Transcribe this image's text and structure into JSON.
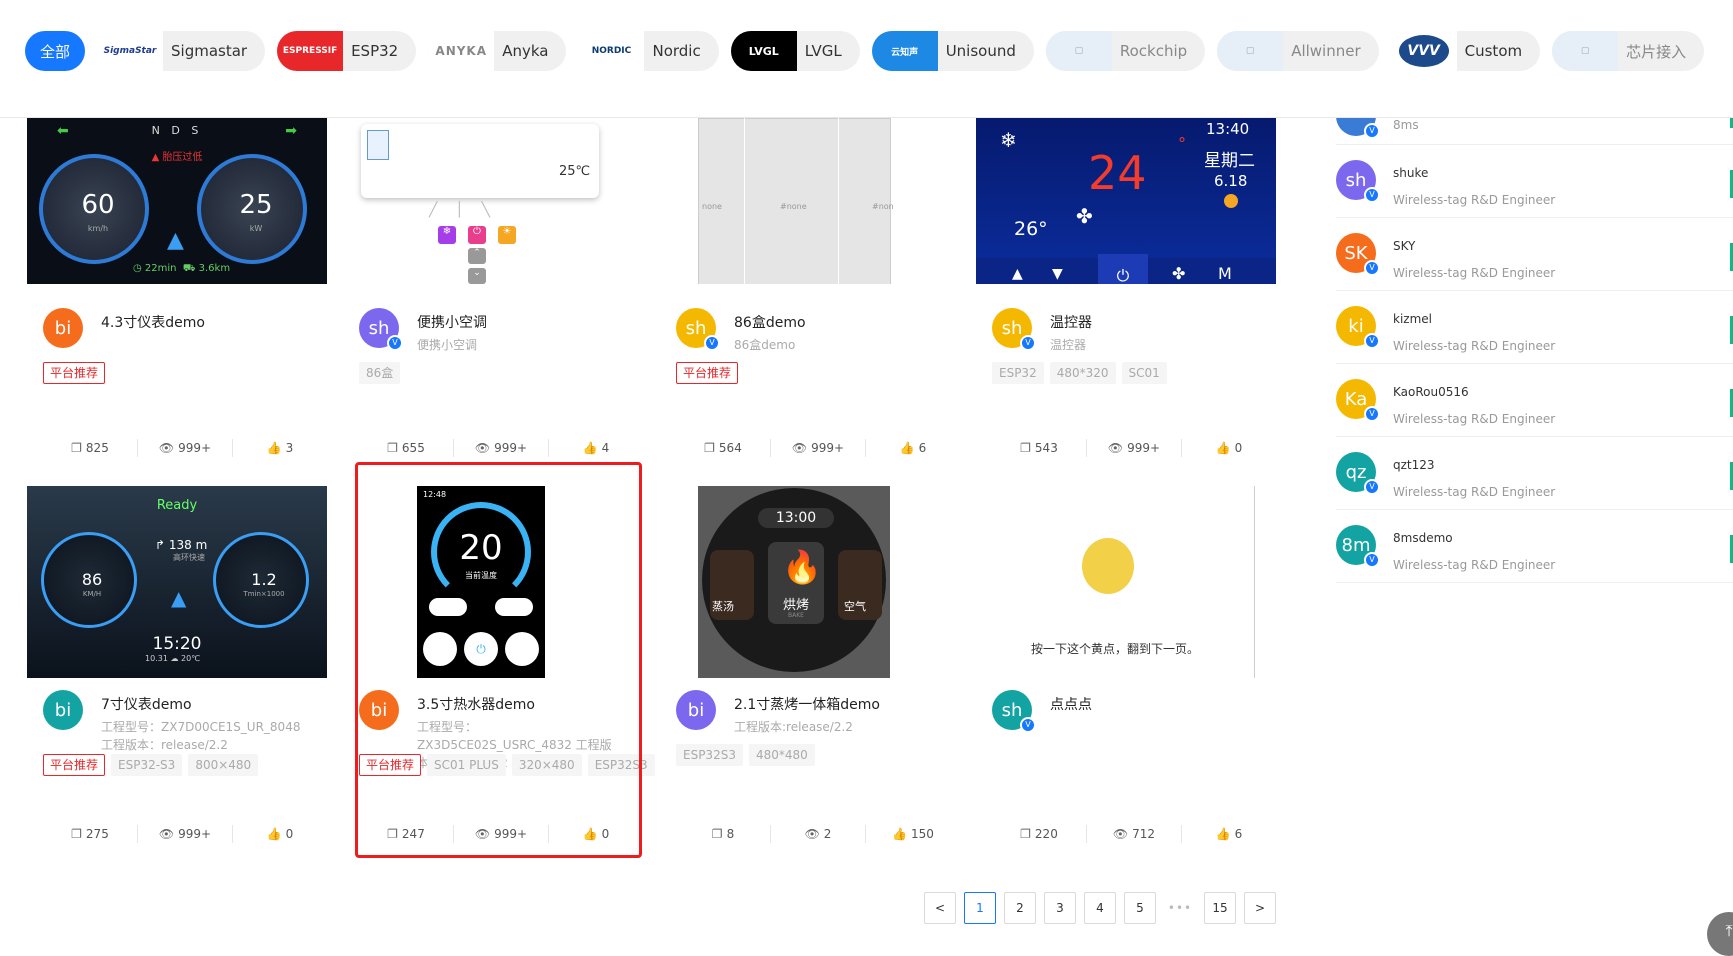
{
  "filters": [
    {
      "label": "全部",
      "active": true
    },
    {
      "label": "Sigmastar",
      "logo": "SigmaStar"
    },
    {
      "label": "ESP32",
      "logo": "ESPRESSIF"
    },
    {
      "label": "Anyka",
      "logo": "ANYKA"
    },
    {
      "label": "Nordic",
      "logo": "NORDIC"
    },
    {
      "label": "LVGL",
      "logo": "LVGL"
    },
    {
      "label": "Unisound",
      "logo": "云知声"
    },
    {
      "label": "Rockchip",
      "dim": true
    },
    {
      "label": "Allwinner",
      "dim": true
    },
    {
      "label": "Custom",
      "logo": "VVV"
    },
    {
      "label": "芯片接入",
      "dim": true
    }
  ],
  "cards": [
    {
      "title": "4.3寸仪表demo",
      "desc": "",
      "avatar": "bi",
      "avatar_color": "#f56c1d",
      "verified": false,
      "tags": [
        "平台推荐"
      ],
      "rec": true,
      "copies": "825",
      "views": "999+",
      "likes": "3",
      "thumb": {
        "type": "dash1",
        "top_text": "N D S",
        "warn": "胎压过低",
        "speed": "60",
        "speed_unit": "km/h",
        "right_val": "25",
        "right_unit": "kW",
        "trip1": "22min",
        "trip2": "3.6km"
      }
    },
    {
      "title": "便携小空调",
      "desc": "便携小空调",
      "avatar": "sh",
      "avatar_color": "#7b68ee",
      "verified": true,
      "tags": [
        "86盒"
      ],
      "rec": false,
      "copies": "655",
      "views": "999+",
      "likes": "4",
      "thumb": {
        "type": "ac",
        "temp": "25℃"
      }
    },
    {
      "title": "86盒demo",
      "desc": "86盒demo",
      "avatar": "sh",
      "avatar_color": "#f5b800",
      "verified": true,
      "tags": [
        "平台推荐"
      ],
      "rec": true,
      "copies": "564",
      "views": "999+",
      "likes": "6",
      "thumb": {
        "type": "none",
        "labels": [
          "none",
          "#none",
          "#non"
        ]
      }
    },
    {
      "title": "温控器",
      "desc": "温控器",
      "avatar": "sh",
      "avatar_color": "#f5b800",
      "verified": true,
      "tags": [
        "ESP32",
        "480*320",
        "SC01"
      ],
      "rec": false,
      "copies": "543",
      "views": "999+",
      "likes": "0",
      "thumb": {
        "type": "thermo",
        "time": "13:40",
        "temp": "24",
        "day": "星期二",
        "date": "6.18",
        "indoor": "26°",
        "mode": "M"
      }
    },
    {
      "title": "7寸仪表demo",
      "desc": "工程型号：ZX7D00CE1S_UR_8048 工程版本：release/2.2",
      "avatar": "bi",
      "avatar_color": "#14a3a3",
      "verified": false,
      "tags": [
        "平台推荐",
        "ESP32-S3",
        "800×480"
      ],
      "rec": true,
      "copies": "275",
      "views": "999+",
      "likes": "0",
      "thumb": {
        "type": "dash2",
        "status": "Ready",
        "dist": "138 m",
        "dist_sub": "高环快速",
        "speed": "86",
        "speed_unit": "KM/H",
        "rpm": "1.2",
        "rpm_unit": "Tmin×1000",
        "clock": "15:20",
        "date": "10.31",
        "weather": "20℃"
      }
    },
    {
      "title": "3.5寸热水器demo",
      "desc": "工程型号：ZX3D5CE02S_USRC_4832 工程版本：release/2.2",
      "avatar": "bi",
      "avatar_color": "#f56c1d",
      "verified": false,
      "tags": [
        "平台推荐",
        "SC01 PLUS",
        "320×480",
        "ESP32S3"
      ],
      "rec": true,
      "copies": "247",
      "views": "999+",
      "likes": "0",
      "thumb": {
        "type": "heater",
        "time": "12:48",
        "temp": "20",
        "label": "当前温度"
      }
    },
    {
      "title": "2.1寸蒸烤一体箱demo",
      "desc": "工程版本:release/2.2",
      "avatar": "bi",
      "avatar_color": "#7b68ee",
      "verified": false,
      "tags": [
        "ESP32S3",
        "480*480"
      ],
      "rec": false,
      "copies": "8",
      "views": "2",
      "likes": "150",
      "thumb": {
        "type": "oven",
        "time": "13:00",
        "left": "蒸汤",
        "center": "烘烤",
        "center_sub": "BAKE",
        "right": "空气"
      }
    },
    {
      "title": "点点点",
      "desc": "",
      "avatar": "sh",
      "avatar_color": "#14a3a3",
      "verified": true,
      "tags": [],
      "rec": false,
      "copies": "220",
      "views": "712",
      "likes": "6",
      "thumb": {
        "type": "dot",
        "caption": "按一下这个黄点，翻到下一页。"
      }
    }
  ],
  "users": [
    {
      "name": "",
      "role": "8ms",
      "avatar": "",
      "color": "#3a7bd5",
      "partial": true
    },
    {
      "name": "shuke",
      "role": "Wireless-tag R&D Engineer",
      "avatar": "sh",
      "color": "#7b68ee"
    },
    {
      "name": "SKY",
      "role": "Wireless-tag R&D Engineer",
      "avatar": "SK",
      "color": "#f56c1d"
    },
    {
      "name": "kizmel",
      "role": "Wireless-tag R&D Engineer",
      "avatar": "ki",
      "color": "#f5b800"
    },
    {
      "name": "KaoRou0516",
      "role": "Wireless-tag R&D Engineer",
      "avatar": "Ka",
      "color": "#f5b800"
    },
    {
      "name": "qzt123",
      "role": "Wireless-tag R&D Engineer",
      "avatar": "qz",
      "color": "#14a3a3"
    },
    {
      "name": "8msdemo",
      "role": "Wireless-tag R&D Engineer",
      "avatar": "8m",
      "color": "#14a3a3"
    }
  ],
  "pagination": {
    "prev": "<",
    "pages": [
      "1",
      "2",
      "3",
      "4",
      "5"
    ],
    "ellipsis": "•••",
    "last": "15",
    "next": ">",
    "current": "1"
  },
  "icons": {
    "copy": "copy-icon",
    "view": "eye-icon",
    "like": "thumb-up-icon",
    "top": "back-to-top-icon"
  }
}
